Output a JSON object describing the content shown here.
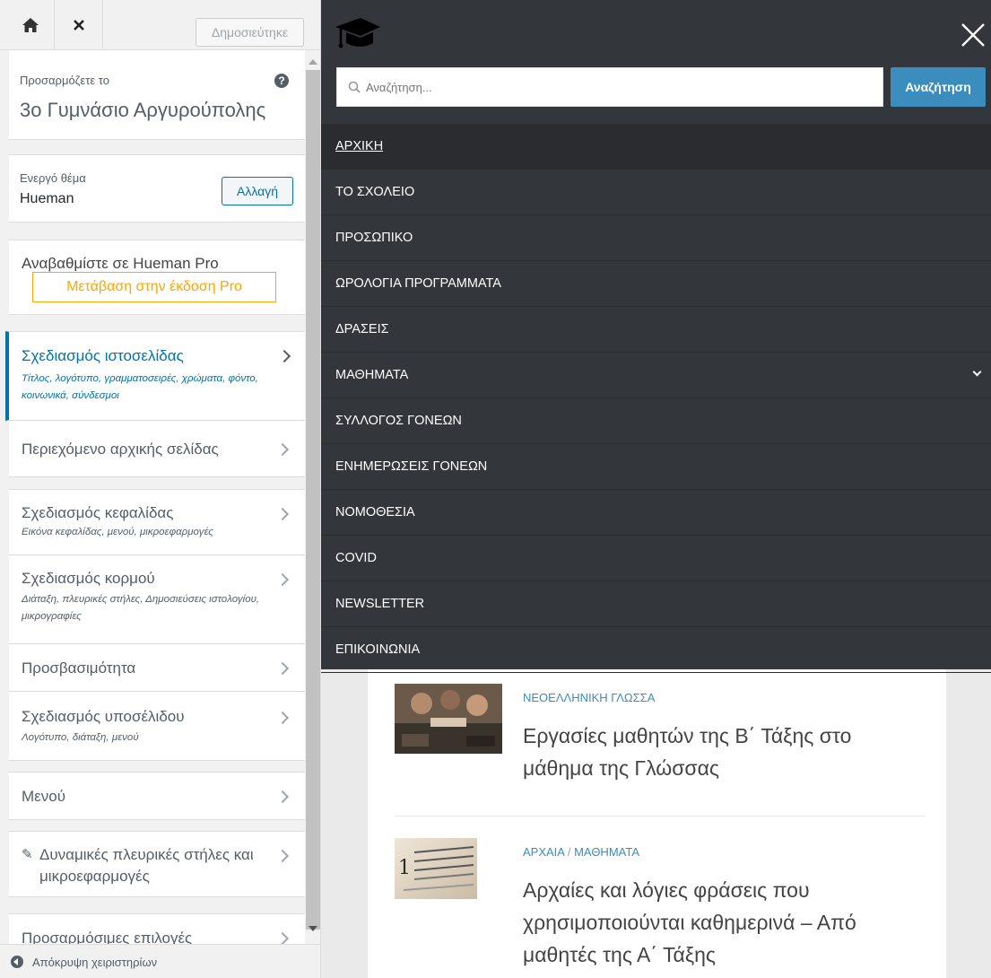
{
  "customizer": {
    "publish_label": "Δημοσιεύτηκε",
    "info_label": "Προσαρμόζετε το",
    "site_title": "3ο Γυμνάσιο Αργυρούπολης",
    "theme": {
      "label": "Ενεργό θέμα",
      "name": "Hueman",
      "change_label": "Αλλαγή"
    },
    "pro": {
      "label": "Αναβαθμίστε σε Hueman Pro",
      "button_label": "Μετάβαση στην έκδοση Pro"
    },
    "panels": [
      {
        "title": "Σχεδιασμός ιστοσελίδας",
        "subtitle": "Τίτλος, λογότυπο, γραμματοσειρές, χρώματα, φόντο, κοινωνικά, σύνδεσμοι"
      },
      {
        "title": "Περιεχόμενο αρχικής σελίδας",
        "subtitle": ""
      },
      {
        "title": "Σχεδιασμός κεφαλίδας",
        "subtitle": "Εικόνα κεφαλίδας, μενού, μικροεφαρμογές"
      },
      {
        "title": "Σχεδιασμός κορμού",
        "subtitle": "Διάταξη, πλευρικές στήλες, Δημοσιεύσεις ιστολογίου, μικρογραφίες"
      },
      {
        "title": "Προσβασιμότητα",
        "subtitle": ""
      },
      {
        "title": "Σχεδιασμός υποσέλιδου",
        "subtitle": "Λογότυπο, διάταξη, μενού"
      },
      {
        "title": "Μενού",
        "subtitle": ""
      },
      {
        "title": "Δυναμικές πλευρικές στήλες και μικροεφαρμογές",
        "subtitle": ""
      },
      {
        "title": "Προσαρμόσιμες επιλογές",
        "subtitle": ""
      }
    ],
    "collapse_label": "Απόκρυψη χειριστηρίων"
  },
  "nav": {
    "search_placeholder": "Αναζήτηση...",
    "search_button": "Αναζήτηση",
    "items": [
      {
        "label": "ΑΡΧΙΚΗ"
      },
      {
        "label": "ΤΟ ΣΧΟΛΕΙΟ"
      },
      {
        "label": "ΠΡΟΣΩΠΙΚΟ"
      },
      {
        "label": "ΩΡΟΛΟΓΙΑ ΠΡΟΓΡΑΜΜΑΤΑ"
      },
      {
        "label": "ΔΡΑΣΕΙΣ"
      },
      {
        "label": "ΜΑΘΗΜΑΤΑ"
      },
      {
        "label": "ΣΥΛΛΟΓΟΣ ΓΟΝΕΩΝ"
      },
      {
        "label": "ΕΝΗΜΕΡΩΣΕΙΣ ΓΟΝΕΩΝ"
      },
      {
        "label": "ΝΟΜΟΘΕΣΙΑ"
      },
      {
        "label": "COVID"
      },
      {
        "label": "NEWSLETTER"
      },
      {
        "label": "ΕΠΙΚΟΙΝΩΝΙΑ"
      }
    ]
  },
  "posts": [
    {
      "category": "ΝΕΟΕΛΛΗΝΙΚΗ ΓΛΩΣΣΑ",
      "title": "Εργασίες μαθητών της Β΄ Τάξης στο μάθημα της Γλώσσας"
    },
    {
      "category_1": "ΑΡΧΑΙΑ",
      "category_sep": " / ",
      "category_2": "ΜΑΘΗΜΑΤΑ",
      "title": "Αρχαίες και λόγιες φράσεις που χρησιμοποιούνται καθημερινά – Από μαθητές της Α΄ Τάξης"
    }
  ],
  "colors": {
    "accent": "#3b8dbd",
    "wp_blue": "#0073aa",
    "pro_orange": "#ffa500",
    "nav_bg": "#33363b"
  }
}
